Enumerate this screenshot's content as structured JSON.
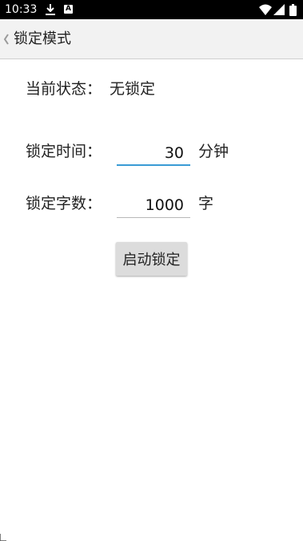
{
  "status_bar": {
    "time": "10:33",
    "badge_letter": "A"
  },
  "action_bar": {
    "title": "锁定模式"
  },
  "lock_status": {
    "label": "当前状态：",
    "value": "无锁定"
  },
  "lock_time": {
    "label": "锁定时间：",
    "value": "30",
    "unit": "分钟"
  },
  "lock_words": {
    "label": "锁定字数：",
    "value": "1000",
    "unit": "字"
  },
  "start_button": {
    "label": "启动锁定"
  },
  "colors": {
    "accent": "#3a9bd5",
    "status_bar": "#000000",
    "action_bar": "#f2f2f2",
    "button": "#dcdcdc"
  }
}
